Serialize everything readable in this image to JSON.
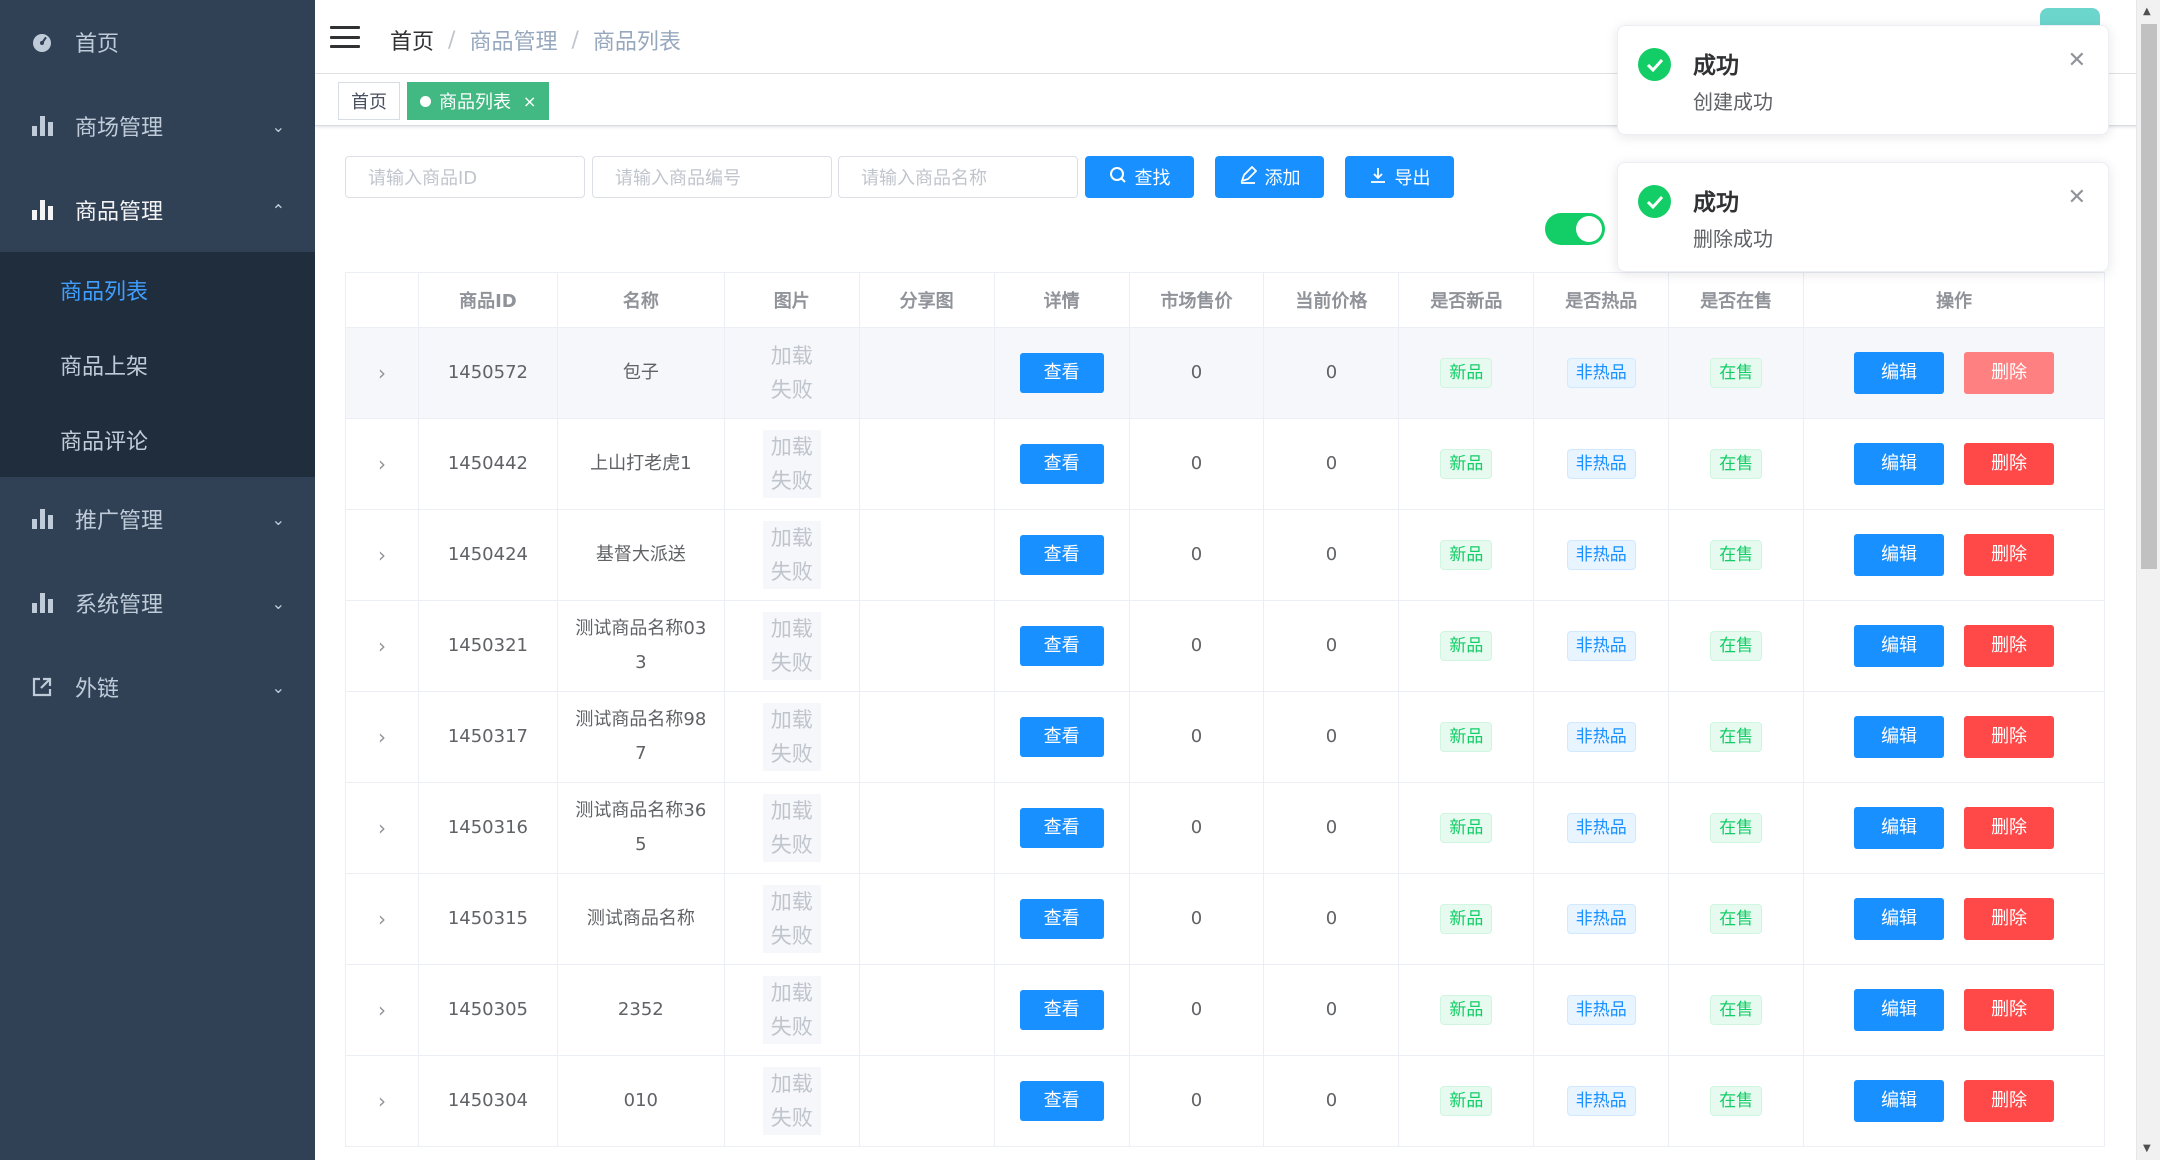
{
  "sidebar": {
    "items": [
      {
        "label": "首页",
        "icon": "dashboard-icon",
        "arrow": ""
      },
      {
        "label": "商场管理",
        "icon": "chart-icon",
        "arrow": "⌄"
      },
      {
        "label": "商品管理",
        "icon": "chart-icon",
        "arrow": "⌃"
      },
      {
        "label": "推广管理",
        "icon": "chart-icon",
        "arrow": "⌄"
      },
      {
        "label": "系统管理",
        "icon": "chart-icon",
        "arrow": "⌄"
      },
      {
        "label": "外链",
        "icon": "external-link-icon",
        "arrow": "⌄"
      }
    ],
    "submenu": [
      "商品列表",
      "商品上架",
      "商品评论"
    ]
  },
  "navbar": {
    "breadcrumb": [
      "首页",
      "商品管理",
      "商品列表"
    ],
    "separator": "/"
  },
  "tags": {
    "home": "首页",
    "active": "商品列表",
    "close": "×"
  },
  "filters": {
    "goods_id_placeholder": "请输入商品ID",
    "goods_sn_placeholder": "请输入商品编号",
    "goods_name_placeholder": "请输入商品名称",
    "search_label": "查找",
    "add_label": "添加",
    "export_label": "导出"
  },
  "table": {
    "headers": [
      "",
      "商品ID",
      "名称",
      "图片",
      "分享图",
      "详情",
      "市场售价",
      "当前价格",
      "是否新品",
      "是否热品",
      "是否在售",
      "操作"
    ],
    "view_label": "查看",
    "edit_label": "编辑",
    "delete_label": "删除",
    "img_fail": "加载失败",
    "rows": [
      {
        "id": "1450572",
        "name": "包子",
        "market_price": "0",
        "price": "0",
        "is_new": "新品",
        "is_hot": "非热品",
        "on_sale": "在售"
      },
      {
        "id": "1450442",
        "name": "上山打老虎1",
        "market_price": "0",
        "price": "0",
        "is_new": "新品",
        "is_hot": "非热品",
        "on_sale": "在售"
      },
      {
        "id": "1450424",
        "name": "基督大派送",
        "market_price": "0",
        "price": "0",
        "is_new": "新品",
        "is_hot": "非热品",
        "on_sale": "在售"
      },
      {
        "id": "1450321",
        "name": "测试商品名称033",
        "market_price": "0",
        "price": "0",
        "is_new": "新品",
        "is_hot": "非热品",
        "on_sale": "在售"
      },
      {
        "id": "1450317",
        "name": "测试商品名称987",
        "market_price": "0",
        "price": "0",
        "is_new": "新品",
        "is_hot": "非热品",
        "on_sale": "在售"
      },
      {
        "id": "1450316",
        "name": "测试商品名称365",
        "market_price": "0",
        "price": "0",
        "is_new": "新品",
        "is_hot": "非热品",
        "on_sale": "在售"
      },
      {
        "id": "1450315",
        "name": "测试商品名称",
        "market_price": "0",
        "price": "0",
        "is_new": "新品",
        "is_hot": "非热品",
        "on_sale": "在售"
      },
      {
        "id": "1450305",
        "name": "2352",
        "market_price": "0",
        "price": "0",
        "is_new": "新品",
        "is_hot": "非热品",
        "on_sale": "在售"
      },
      {
        "id": "1450304",
        "name": "010",
        "market_price": "0",
        "price": "0",
        "is_new": "新品",
        "is_hot": "非热品",
        "on_sale": "在售"
      }
    ]
  },
  "notifications": [
    {
      "title": "成功",
      "message": "创建成功"
    },
    {
      "title": "成功",
      "message": "删除成功"
    }
  ],
  "colors": {
    "sidebar_bg": "#304156",
    "primary": "#1890ff",
    "danger": "#ff4949",
    "success": "#13ce66",
    "tag_active": "#42b983"
  }
}
